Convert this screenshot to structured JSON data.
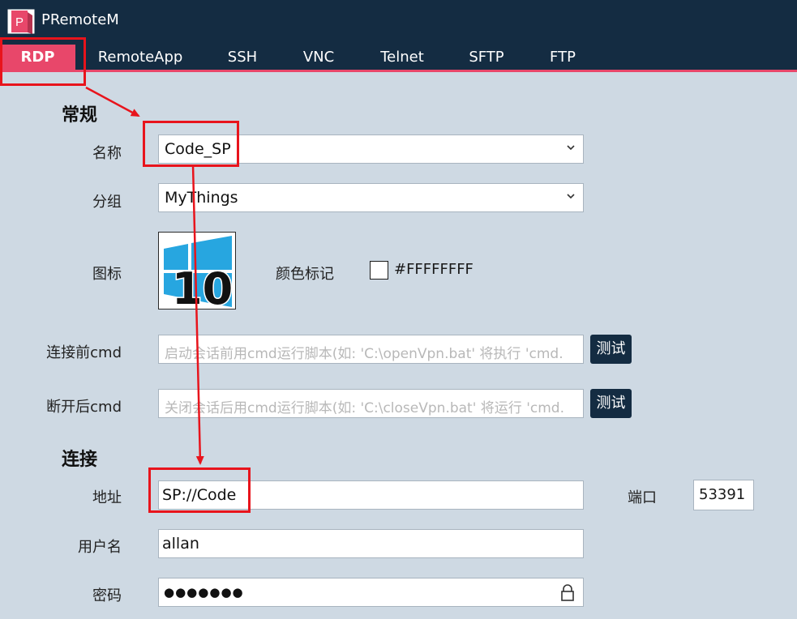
{
  "app": {
    "title": "PRemoteM",
    "logo_letter": "P"
  },
  "tabs": [
    {
      "label": "RDP",
      "active": true
    },
    {
      "label": "RemoteApp",
      "active": false
    },
    {
      "label": "SSH",
      "active": false
    },
    {
      "label": "VNC",
      "active": false
    },
    {
      "label": "Telnet",
      "active": false
    },
    {
      "label": "SFTP",
      "active": false
    },
    {
      "label": "FTP",
      "active": false
    }
  ],
  "general": {
    "section_title": "常规",
    "name_label": "名称",
    "name_value": "Code_SP",
    "group_label": "分组",
    "group_value": "MyThings",
    "icon_label": "图标",
    "icon_badge": "10",
    "color_label": "颜色标记",
    "color_value": "#FFFFFFFF",
    "pre_cmd_label": "连接前cmd",
    "pre_cmd_placeholder": "启动会话前用cmd运行脚本(如: 'C:\\openVpn.bat' 将执行 'cmd.",
    "pre_cmd_test": "测试",
    "post_cmd_label": "断开后cmd",
    "post_cmd_placeholder": "关闭会话后用cmd运行脚本(如: 'C:\\closeVpn.bat' 将运行 'cmd.",
    "post_cmd_test": "测试"
  },
  "connection": {
    "section_title": "连接",
    "address_label": "地址",
    "address_value": "SP://Code",
    "port_label": "端口",
    "port_value": "53391",
    "username_label": "用户名",
    "username_value": "allan",
    "password_label": "密码",
    "password_value": "●●●●●●●"
  },
  "colors": {
    "titlebar": "#142c42",
    "accent": "#e8476a",
    "background": "#ced9e3",
    "annotation": "#e8141c"
  }
}
